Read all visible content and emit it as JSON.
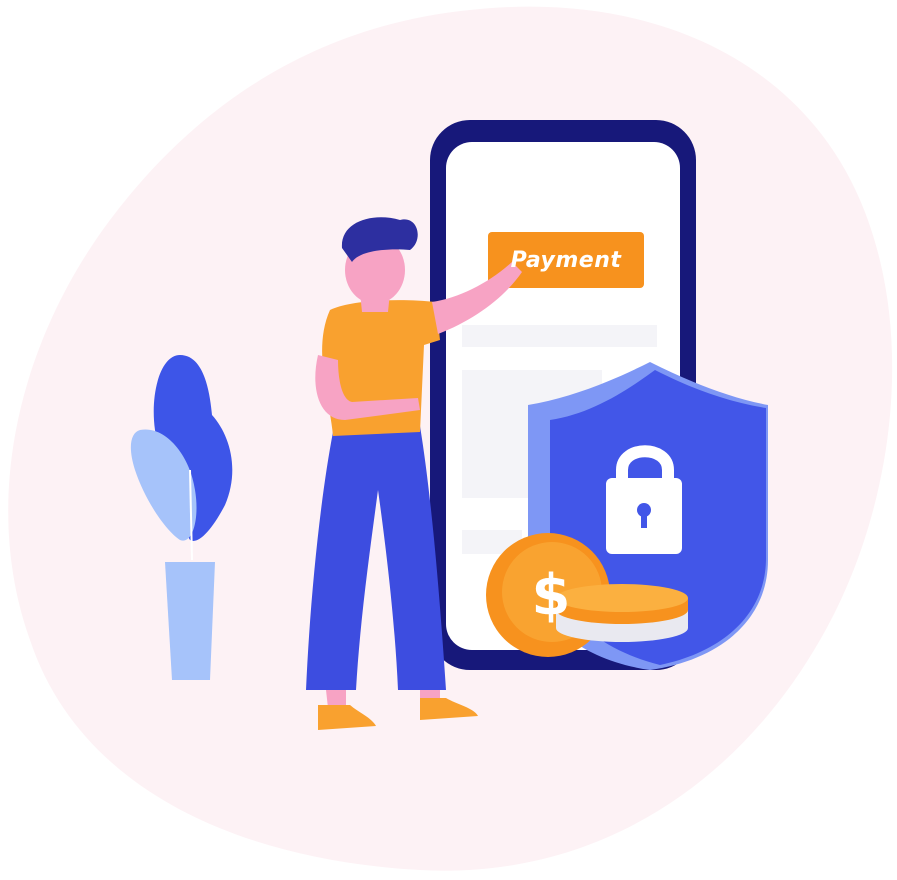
{
  "illustration": {
    "payment_button_label": "Payment",
    "currency_symbol": "$"
  },
  "colors": {
    "background_blob": "#fdf2f5",
    "phone_frame": "#17187a",
    "phone_screen": "#ffffff",
    "payment_button": "#f7921e",
    "shield_primary": "#4256e8",
    "shield_light": "#7e97f5",
    "coin_orange": "#f7921e",
    "coin_light": "#fbb040",
    "shirt": "#f9a12f",
    "skin": "#f7a3c4",
    "hair": "#2d2fa0",
    "pants": "#3d4de0",
    "plant_dark": "#3d55e8",
    "plant_light": "#a6c3fa"
  }
}
